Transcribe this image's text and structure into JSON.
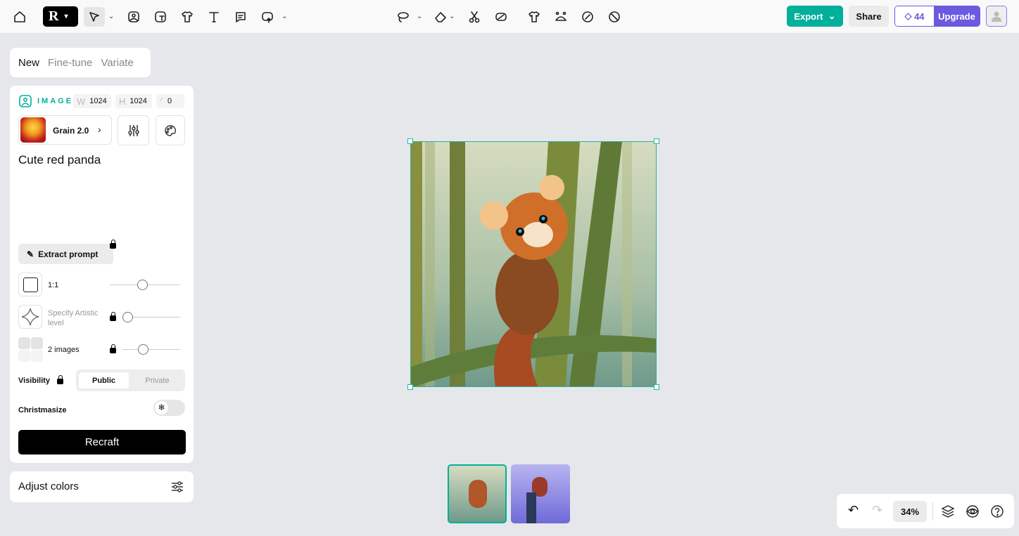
{
  "toolbar": {
    "left_icons": [
      "home-icon",
      "logo-menu",
      "select-pointer-icon",
      "image-frame-icon",
      "text-frame-icon",
      "mockup-shirt-icon",
      "text-tool-icon",
      "comment-icon",
      "upload-image-icon"
    ],
    "center_icons": [
      "lasso-icon",
      "eraser-icon",
      "scissors-icon",
      "remove-background-icon",
      "shirt-icon",
      "inpaint-icon",
      "edit-brush-icon",
      "magic-icon"
    ],
    "export_label": "Export",
    "share_label": "Share",
    "credits": "44",
    "upgrade_label": "Upgrade"
  },
  "tabs": [
    {
      "label": "New",
      "active": true
    },
    {
      "label": "Fine-tune"
    },
    {
      "label": "Variate"
    }
  ],
  "panel": {
    "type_label": "IMAGE",
    "w_label": "W",
    "width": "1024",
    "h_label": "H",
    "height": "1024",
    "corner": "0",
    "model": "Grain 2.0",
    "prompt": "Cute red panda",
    "extract_label": "Extract prompt",
    "aspect": "1:1",
    "artistic_label": "Specify Artistic level",
    "images_label": "2 images",
    "visibility_label": "Visibility",
    "public_label": "Public",
    "private_label": "Private",
    "christmasize_label": "Christmasize",
    "christmasize_on": false,
    "recraft_label": "Recraft",
    "aspect_slider": 0.5,
    "artistic_slider": 0,
    "images_slider": 0.33
  },
  "adjust": {
    "label": "Adjust colors"
  },
  "bottom": {
    "zoom": "34%"
  },
  "colors": {
    "accent": "#00b09b",
    "upgrade": "#6a5ae0",
    "selection": "#2ab3a0"
  }
}
